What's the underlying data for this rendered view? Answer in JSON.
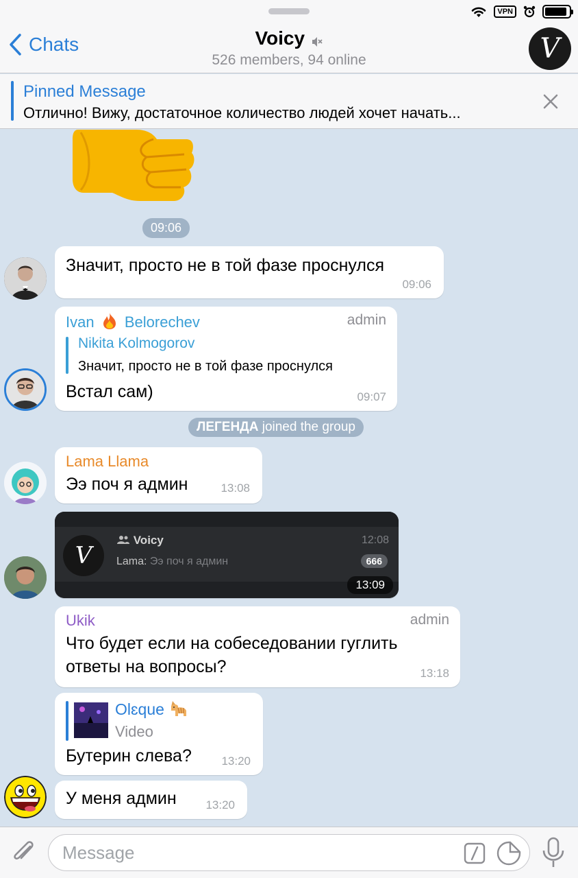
{
  "header": {
    "back_label": "Chats",
    "title": "Voicy",
    "subtitle": "526 members, 94 online",
    "avatar_letter": "V",
    "status_vpn": "VPN"
  },
  "pinned": {
    "title": "Pinned Message",
    "text": "Отлично! Вижу, достаточное количество людей хочет начать..."
  },
  "messages": {
    "sticker_time": "09:06",
    "m1": {
      "text": "Значит, просто не в той фазе проснулся",
      "time": "09:06"
    },
    "m2": {
      "sender_first": "Ivan",
      "sender_last": "Belorechev",
      "role": "admin",
      "reply_name": "Nikita Kolmogorov",
      "reply_text": "Значит, просто не в той фазе проснулся",
      "text": "Встал сам)",
      "time": "09:07"
    },
    "service": {
      "name": "ЛЕГЕНДА",
      "action": "joined the group"
    },
    "m3": {
      "sender": "Lama Llama",
      "text": "Ээ поч я админ",
      "time": "13:08"
    },
    "m4": {
      "shot_chat_name": "Voicy",
      "shot_chat_time": "12:08",
      "shot_sender": "Lama:",
      "shot_preview": "Ээ поч я админ",
      "shot_badge": "666",
      "shot_avatar_letter": "V",
      "time": "13:09"
    },
    "m5": {
      "sender": "Ukik",
      "role": "admin",
      "line1": "Что будет если на собеседовании гуглить",
      "line2": "ответы на вопросы?",
      "time": "13:18"
    },
    "m6": {
      "reply_name": "Olɛque",
      "reply_type": "Video",
      "text": "Бутерин слева?",
      "time": "13:20"
    },
    "m7": {
      "text": "У меня админ",
      "time": "13:20"
    }
  },
  "input": {
    "placeholder": "Message"
  },
  "colors": {
    "accent": "#2b7fd7",
    "sender_ivan": "#3a9fd6",
    "sender_lama": "#e88a2a",
    "sender_ukik": "#8e5cc6",
    "chat_bg": "#d6e2ee"
  },
  "icons": [
    "wifi-icon",
    "alarm-icon",
    "battery-icon",
    "chevron-left-icon",
    "mute-icon",
    "close-icon",
    "fire-emoji",
    "cat-emoji",
    "attach-icon",
    "command-icon",
    "sticker-icon",
    "microphone-icon",
    "thumbs-sticker"
  ]
}
